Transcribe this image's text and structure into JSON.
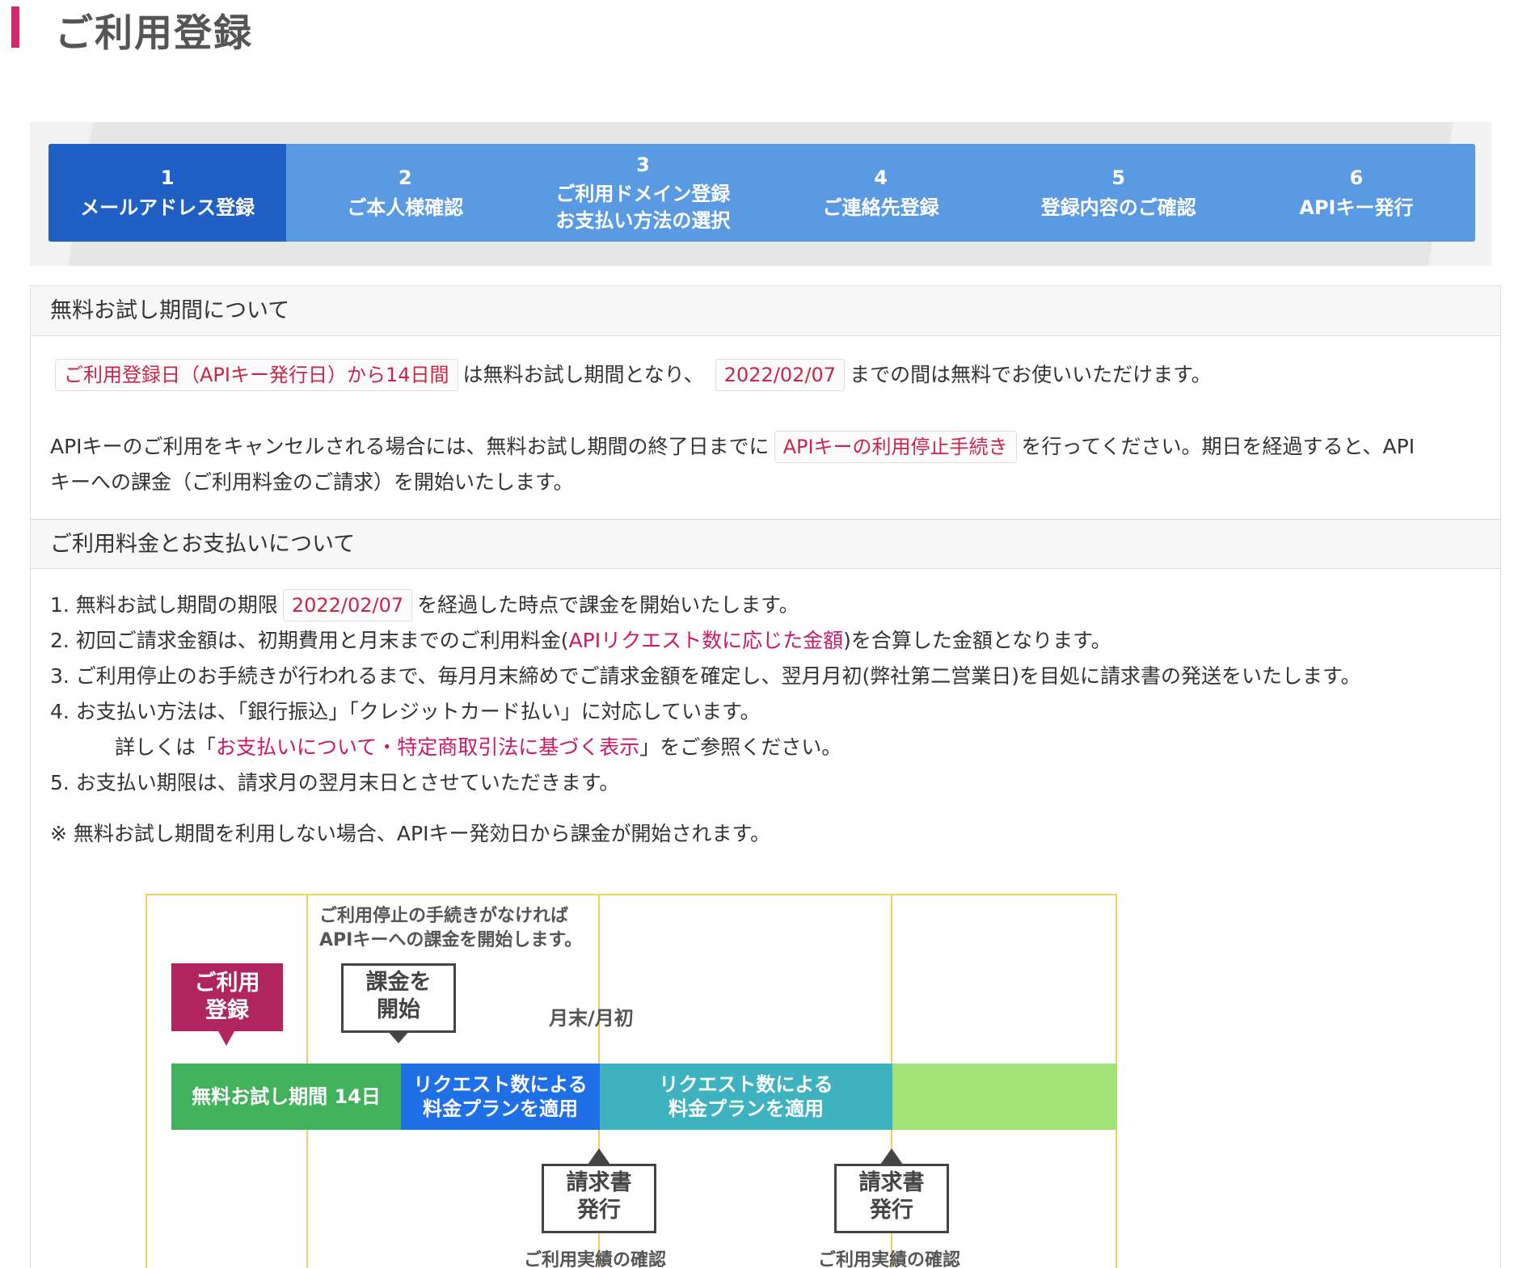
{
  "page": {
    "title": "ご利用登録"
  },
  "steps": [
    {
      "num": "1",
      "lines": [
        "メールアドレス登録"
      ]
    },
    {
      "num": "2",
      "lines": [
        "ご本人様確認"
      ]
    },
    {
      "num": "3",
      "lines": [
        "ご利用ドメイン登録",
        "お支払い方法の選択"
      ]
    },
    {
      "num": "4",
      "lines": [
        "ご連絡先登録"
      ]
    },
    {
      "num": "5",
      "lines": [
        "登録内容のご確認"
      ]
    },
    {
      "num": "6",
      "lines": [
        "APIキー発行"
      ]
    }
  ],
  "trial": {
    "heading": "無料お試し期間について",
    "line1_pill": "ご利用登録日（APIキー発行日）から14日間",
    "line1_mid": "は無料お試し期間となり、",
    "line1_date": "2022/02/07",
    "line1_end": "までの間は無料でお使いいただけます。",
    "line2_start": "APIキーのご利用をキャンセルされる場合には、無料お試し期間の終了日までに",
    "line2_pill": "APIキーの利用停止手続き",
    "line2_end": "を行ってください。期日を経過すると、API",
    "line3": "キーへの課金（ご利用料金のご請求）を開始いたします。"
  },
  "billing": {
    "heading": "ご利用料金とお支払いについて",
    "item1_start": "1. 無料お試し期間の期限",
    "item1_date": "2022/02/07",
    "item1_end": "を経過した時点で課金を開始いたします。",
    "item2_start": "2. 初回ご請求金額は、初期費用と月末までのご利用料金(",
    "item2_link": "APIリクエスト数に応じた金額",
    "item2_end": ")を合算した金額となります。",
    "item3": "3. ご利用停止のお手続きが行われるまで、毎月月末締めでご請求金額を確定し、翌月月初(弊社第二営業日)を目処に請求書の発送をいたします。",
    "item4": "4. お支払い方法は、「銀行振込」「クレジットカード払い」に対応しています。",
    "item4b_start": "詳しくは「",
    "item4b_link": "お支払いについて・特定商取引法に基づく表示",
    "item4b_end": "」をご参照ください。",
    "item5": "5. お支払い期限は、請求月の翌月末日とさせていただきます。",
    "note": "※ 無料お試し期間を利用しない場合、APIキー発効日から課金が開始されます。"
  },
  "diagram": {
    "note_top1": "ご利用停止の手続きがなければ",
    "note_top2": "APIキーへの課金を開始します。",
    "badge1": "ご利用",
    "badge2": "登録",
    "start1": "課金を",
    "start2": "開始",
    "month": "月末/月初",
    "bar1": "無料お試し期間 14日",
    "bar2a": "リクエスト数による",
    "bar2b": "料金プランを適用",
    "bar3a": "リクエスト数による",
    "bar3b": "料金プランを適用",
    "invoice1": "請求書",
    "invoice2": "発行",
    "caption": "ご利用実績の確認"
  },
  "colors": {
    "accent": "#d12a73",
    "step_active": "#2060c4",
    "step_inactive": "#5a9ae3",
    "pill_text": "#c7254e",
    "link": "#c8186a"
  }
}
